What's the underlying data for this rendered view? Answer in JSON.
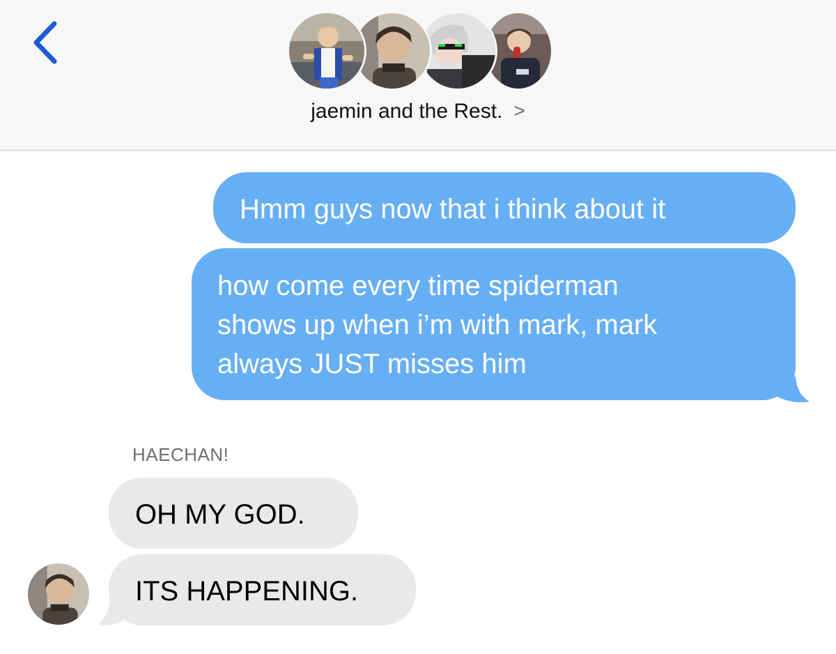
{
  "header": {
    "back_icon": "chevron-left-icon",
    "group_name": "jaemin and the Rest.",
    "details_icon": "chevron-right-icon",
    "colors": {
      "accent": "#1a5bd6",
      "header_bg": "#f7f7f7"
    }
  },
  "conversation": {
    "outgoing_color": "#67aff5",
    "incoming_color": "#e9e9eb",
    "messages": [
      {
        "direction": "outgoing",
        "text": "Hmm guys now that i think about it"
      },
      {
        "direction": "outgoing",
        "text": "how come every time spiderman\nshows up when i’m with mark, mark\nalways JUST misses him"
      },
      {
        "direction": "incoming",
        "sender": "HAECHAN!",
        "text": "OH MY GOD."
      },
      {
        "direction": "incoming",
        "text": "ITS HAPPENING."
      }
    ]
  }
}
